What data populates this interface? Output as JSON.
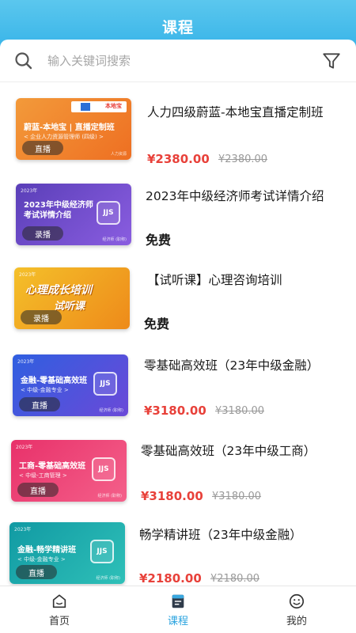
{
  "header": {
    "title": "课程"
  },
  "search": {
    "placeholder": "输入关键词搜索"
  },
  "courses": [
    {
      "title": "人力四级蔚蓝-本地宝直播定制班",
      "price": "¥2380.00",
      "original_price": "¥2380.00",
      "thumb": {
        "line1": "蔚蓝-本地宝 | 直播定制班",
        "line2": "< 企业人力资源管理师 (四级) >",
        "mode": "直播",
        "brand": "人力资源",
        "year": "",
        "bg": "#f5892d"
      }
    },
    {
      "title": "2023年中级经济师考试详情介绍",
      "free_label": "免费",
      "thumb": {
        "line1": "2023年中级经济师",
        "line1b": "考试详情介绍",
        "mode": "录播",
        "brand": "经济师 (职称)",
        "year": "2023年",
        "bg": "#6a4fc9"
      }
    },
    {
      "title": "【试听课】心理咨询培训",
      "free_label": "免费",
      "thumb": {
        "line1": "心理成长培训",
        "line1b": "试听课",
        "mode": "录播",
        "year": "2023年",
        "bg": "#f0a21a"
      }
    },
    {
      "title": "零基础高效班（23年中级金融）",
      "price": "¥3180.00",
      "original_price": "¥3180.00",
      "thumb": {
        "line1": "金融-零基础高效班",
        "line2": "< 中级-金融专业 >",
        "mode": "直播",
        "brand": "经济师 (职称)",
        "year": "2023年",
        "bg": "#3c58d8"
      }
    },
    {
      "title": "零基础高效班（23年中级工商）",
      "price": "¥3180.00",
      "original_price": "¥3180.00",
      "thumb": {
        "line1": "工商-零基础高效班",
        "line2": "< 中级-工商管理 >",
        "mode": "直播",
        "brand": "经济师 (职称)",
        "year": "2023年",
        "bg": "#e8356e"
      }
    },
    {
      "title": "畅学精讲班（23年中级金融）",
      "price": "¥2180.00",
      "original_price": "¥2180.00",
      "thumb": {
        "line1": "金融-畅学精讲班",
        "line2": "< 中级-金融专业 >",
        "mode": "直播",
        "brand": "经济师 (职称)",
        "year": "2023年",
        "bg": "#1aa3a8"
      }
    }
  ],
  "tabbar": [
    {
      "label": "首页",
      "icon": "home-icon"
    },
    {
      "label": "课程",
      "icon": "course-icon",
      "active": true
    },
    {
      "label": "我的",
      "icon": "profile-icon"
    }
  ],
  "colors": {
    "accent": "#36b3e8",
    "price": "#e8413a",
    "active_tab": "#2aa3df"
  }
}
